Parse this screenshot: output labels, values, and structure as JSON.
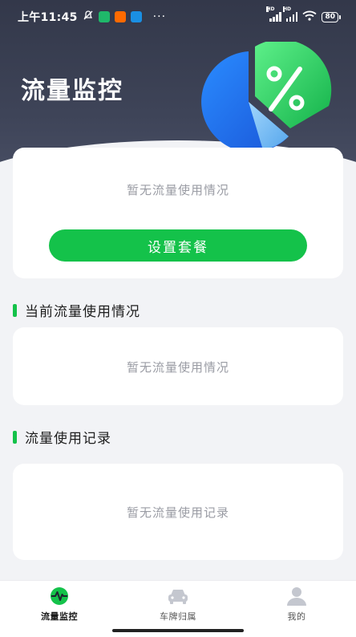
{
  "status_bar": {
    "time": "上午11:45",
    "more": "···",
    "battery": "80",
    "signal_hd": "HD"
  },
  "hero": {
    "title": "流量监控"
  },
  "top_card": {
    "empty_text": "暂无流量使用情况",
    "setup_button": "设置套餐"
  },
  "current_usage": {
    "title": "当前流量使用情况",
    "empty_text": "暂无流量使用情况"
  },
  "usage_records": {
    "title": "流量使用记录",
    "empty_text": "暂无流量使用记录"
  },
  "tabbar": {
    "tabs": [
      {
        "label": "流量监控",
        "icon": "pulse-icon",
        "active": true
      },
      {
        "label": "车牌归属",
        "icon": "car-icon",
        "active": false
      },
      {
        "label": "我的",
        "icon": "person-icon",
        "active": false
      }
    ]
  },
  "colors": {
    "accent": "#14c24a",
    "hero_bg": "#3a3f52",
    "page_bg": "#f2f3f6"
  }
}
